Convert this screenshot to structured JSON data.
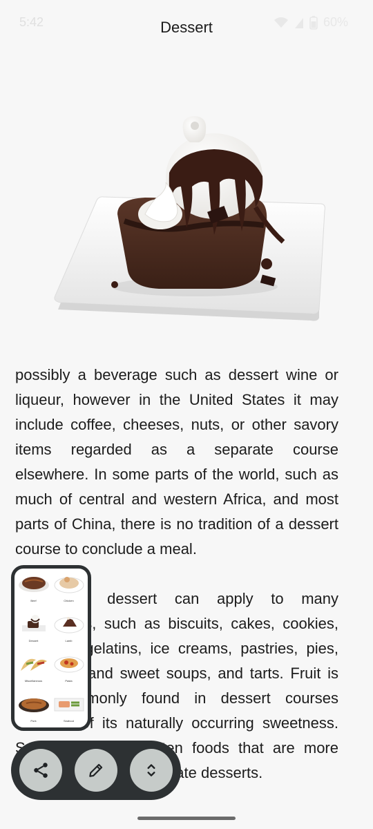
{
  "status_bar": {
    "time": "5:42",
    "battery": "60%"
  },
  "header": {
    "title": "Dessert"
  },
  "hero": {
    "icon": "dessert-lava-cake-image"
  },
  "article": {
    "paragraphs": [
      "possibly a beverage such as dessert wine or liqueur, however in the United States it may include coffee, cheeses, nuts, or other savory items regarded as a separate course elsewhere. In some parts of the world, such as much of central and western Africa, and most parts of China, there is no tradition of a dessert course to conclude a meal.",
      "The term dessert can apply to many confections, such as biscuits, cakes, cookies, custards, gelatins, ice creams, pastries, pies, puddings, and sweet soups, and tarts. Fruit is also commonly found in dessert courses because of its naturally occurring sweetness. Some cultures sweeten foods that are more commonly savory to create desserts."
    ]
  },
  "thumbnails": [
    {
      "label": "Beef",
      "icon": "steak-thumbnail"
    },
    {
      "label": "Chicken",
      "icon": "chicken-thumbnail"
    },
    {
      "label": "Dessert",
      "icon": "dessert-thumbnail"
    },
    {
      "label": "Lamb",
      "icon": "lamb-thumbnail"
    },
    {
      "label": "Miscellaneous",
      "icon": "tacos-thumbnail"
    },
    {
      "label": "Pasta",
      "icon": "pasta-thumbnail"
    },
    {
      "label": "Pork",
      "icon": "pork-thumbnail"
    },
    {
      "label": "Seafood",
      "icon": "seafood-thumbnail"
    }
  ],
  "actions": {
    "share": "share-icon",
    "edit": "pencil-icon",
    "expand": "unfold-icon"
  },
  "colors": {
    "fab_bar": "#2d3133",
    "fab_button": "#c6cbc9",
    "background": "#f7f7f7"
  }
}
